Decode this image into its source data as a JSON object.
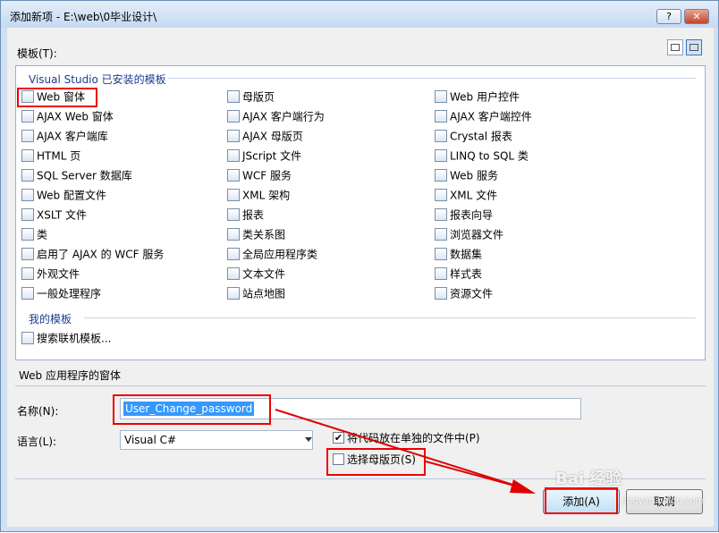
{
  "window": {
    "title": "添加新项 - E:\\web\\0毕业设计\\",
    "help_label": "?",
    "close_label": "✕"
  },
  "templates": {
    "label": "模板(T):",
    "installed_header": "Visual Studio 已安装的模板",
    "my_header": "我的模板",
    "columns": [
      [
        "Web 窗体",
        "AJAX Web 窗体",
        "AJAX 客户端库",
        "HTML 页",
        "SQL Server 数据库",
        "Web 配置文件",
        "XSLT 文件",
        "类",
        "启用了 AJAX 的 WCF 服务",
        "外观文件",
        "一般处理程序"
      ],
      [
        "母版页",
        "AJAX 客户端行为",
        "AJAX 母版页",
        "JScript 文件",
        "WCF 服务",
        "XML 架构",
        "报表",
        "类关系图",
        "全局应用程序类",
        "文本文件",
        "站点地图"
      ],
      [
        "Web 用户控件",
        "AJAX 客户端控件",
        "Crystal 报表",
        "LINQ to SQL 类",
        "Web 服务",
        "XML 文件",
        "报表向导",
        "浏览器文件",
        "数据集",
        "样式表",
        "资源文件"
      ]
    ],
    "my_items": [
      "搜索联机模板..."
    ],
    "selected": "Web 窗体",
    "description": "Web 应用程序的窗体"
  },
  "form": {
    "name_label": "名称(N):",
    "name_value": "User_Change_password",
    "language_label": "语言(L):",
    "language_value": "Visual C#",
    "code_separate_label": "将代码放在单独的文件中(P)",
    "code_separate_checked": "✔",
    "master_page_label": "选择母版页(S)",
    "master_page_checked": ""
  },
  "buttons": {
    "add": "添加(A)",
    "cancel": "取消"
  },
  "watermark": {
    "text": "Bai 经验",
    "url": "jingyan.baidu.com"
  },
  "colors": {
    "annotation": "#e00000",
    "selection": "#3399ff"
  }
}
